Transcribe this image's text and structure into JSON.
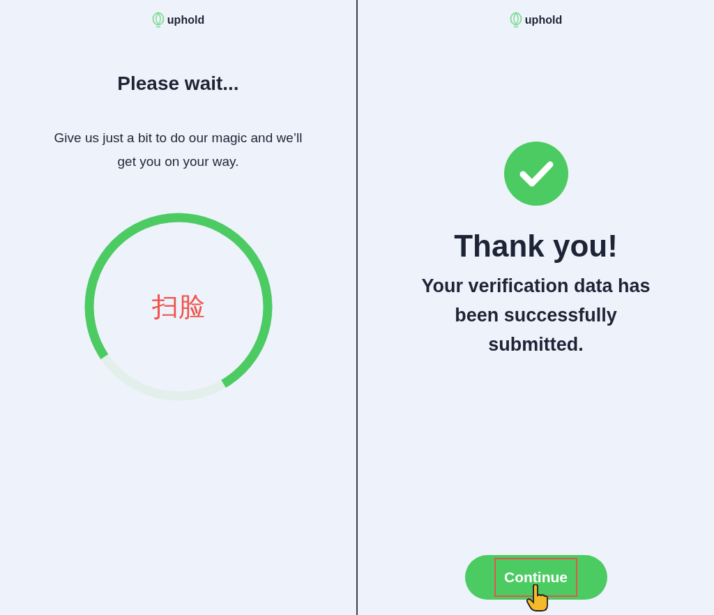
{
  "panels": [
    {
      "kind": "progress",
      "logo": "uphold",
      "title": "Please wait...",
      "message": "Give us just a bit to do our magic and we’ll get you on your way.",
      "progress": {
        "label": "扫脸"
      }
    },
    {
      "kind": "success",
      "logo": "uphold",
      "title": "Thank you!",
      "message": "Your verification data has been successfully submitted.",
      "button": {
        "label": "Continue",
        "highlighted": true
      }
    }
  ]
}
